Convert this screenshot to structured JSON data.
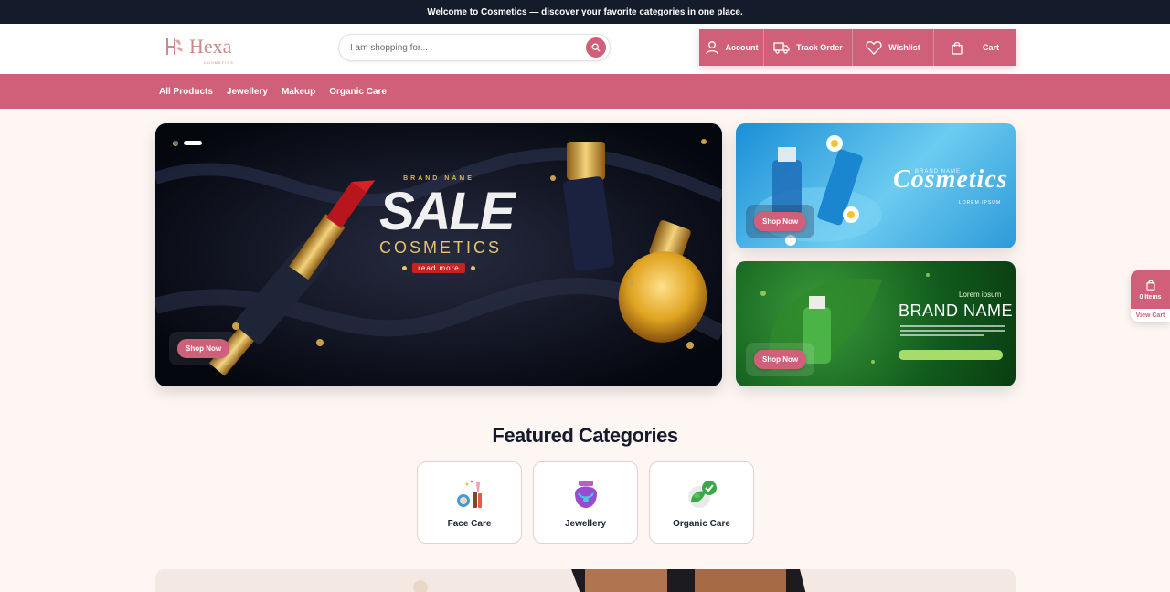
{
  "topbar": {
    "text": "Welcome to Cosmetics — discover your favorite categories in one place."
  },
  "logo": {
    "word": "Hexa",
    "sub": "COSMETICS"
  },
  "search": {
    "placeholder": "I am shopping for..."
  },
  "actions": [
    {
      "label": "Account",
      "icon": "user-icon"
    },
    {
      "label": "Track Order",
      "icon": "truck-icon"
    },
    {
      "label": "Wishlist",
      "icon": "heart-icon"
    },
    {
      "label": "Cart",
      "icon": "bag-icon"
    }
  ],
  "nav": [
    "All Products",
    "Jewellery",
    "Makeup",
    "Organic Care"
  ],
  "hero": {
    "brand": "BRAND NAME",
    "headline": "SALE",
    "subheadline": "COSMETICS",
    "read_more": "read more",
    "shop_now": "Shop Now",
    "slides": 2,
    "active_slide": 2
  },
  "banner_blue": {
    "small": "BRAND NAME",
    "title": "Cosmetics",
    "lorem": "LOREM IPSUM",
    "shop_now": "Shop Now"
  },
  "banner_green": {
    "lorem": "Lorem ipsum",
    "title": "BRAND NAME",
    "shop_now": "Shop Now"
  },
  "featured": {
    "title": "Featured Categories",
    "categories": [
      {
        "label": "Face Care",
        "icon": "makeup-icon"
      },
      {
        "label": "Jewellery",
        "icon": "necklace-icon"
      },
      {
        "label": "Organic Care",
        "icon": "leaf-check-icon"
      }
    ]
  },
  "float_cart": {
    "count": "0 Items",
    "link": "View Cart"
  },
  "colors": {
    "accent": "#d0607a",
    "dark": "#141c2b",
    "background": "#fdf6f3"
  }
}
